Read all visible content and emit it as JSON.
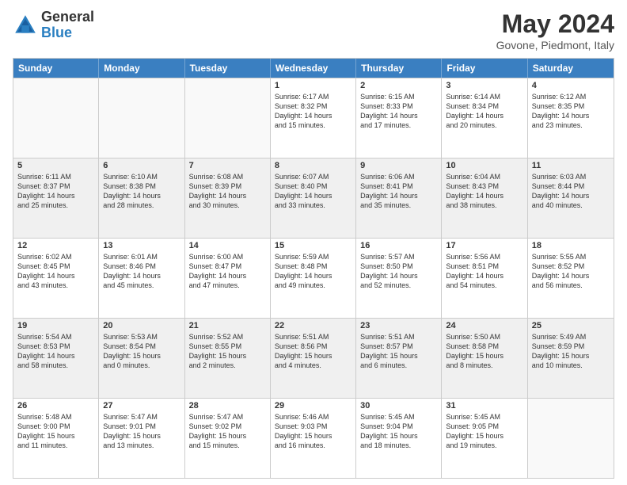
{
  "logo": {
    "general": "General",
    "blue": "Blue"
  },
  "title": "May 2024",
  "location": "Govone, Piedmont, Italy",
  "days": [
    "Sunday",
    "Monday",
    "Tuesday",
    "Wednesday",
    "Thursday",
    "Friday",
    "Saturday"
  ],
  "weeks": [
    [
      {
        "day": "",
        "info": ""
      },
      {
        "day": "",
        "info": ""
      },
      {
        "day": "",
        "info": ""
      },
      {
        "day": "1",
        "info": "Sunrise: 6:17 AM\nSunset: 8:32 PM\nDaylight: 14 hours\nand 15 minutes."
      },
      {
        "day": "2",
        "info": "Sunrise: 6:15 AM\nSunset: 8:33 PM\nDaylight: 14 hours\nand 17 minutes."
      },
      {
        "day": "3",
        "info": "Sunrise: 6:14 AM\nSunset: 8:34 PM\nDaylight: 14 hours\nand 20 minutes."
      },
      {
        "day": "4",
        "info": "Sunrise: 6:12 AM\nSunset: 8:35 PM\nDaylight: 14 hours\nand 23 minutes."
      }
    ],
    [
      {
        "day": "5",
        "info": "Sunrise: 6:11 AM\nSunset: 8:37 PM\nDaylight: 14 hours\nand 25 minutes."
      },
      {
        "day": "6",
        "info": "Sunrise: 6:10 AM\nSunset: 8:38 PM\nDaylight: 14 hours\nand 28 minutes."
      },
      {
        "day": "7",
        "info": "Sunrise: 6:08 AM\nSunset: 8:39 PM\nDaylight: 14 hours\nand 30 minutes."
      },
      {
        "day": "8",
        "info": "Sunrise: 6:07 AM\nSunset: 8:40 PM\nDaylight: 14 hours\nand 33 minutes."
      },
      {
        "day": "9",
        "info": "Sunrise: 6:06 AM\nSunset: 8:41 PM\nDaylight: 14 hours\nand 35 minutes."
      },
      {
        "day": "10",
        "info": "Sunrise: 6:04 AM\nSunset: 8:43 PM\nDaylight: 14 hours\nand 38 minutes."
      },
      {
        "day": "11",
        "info": "Sunrise: 6:03 AM\nSunset: 8:44 PM\nDaylight: 14 hours\nand 40 minutes."
      }
    ],
    [
      {
        "day": "12",
        "info": "Sunrise: 6:02 AM\nSunset: 8:45 PM\nDaylight: 14 hours\nand 43 minutes."
      },
      {
        "day": "13",
        "info": "Sunrise: 6:01 AM\nSunset: 8:46 PM\nDaylight: 14 hours\nand 45 minutes."
      },
      {
        "day": "14",
        "info": "Sunrise: 6:00 AM\nSunset: 8:47 PM\nDaylight: 14 hours\nand 47 minutes."
      },
      {
        "day": "15",
        "info": "Sunrise: 5:59 AM\nSunset: 8:48 PM\nDaylight: 14 hours\nand 49 minutes."
      },
      {
        "day": "16",
        "info": "Sunrise: 5:57 AM\nSunset: 8:50 PM\nDaylight: 14 hours\nand 52 minutes."
      },
      {
        "day": "17",
        "info": "Sunrise: 5:56 AM\nSunset: 8:51 PM\nDaylight: 14 hours\nand 54 minutes."
      },
      {
        "day": "18",
        "info": "Sunrise: 5:55 AM\nSunset: 8:52 PM\nDaylight: 14 hours\nand 56 minutes."
      }
    ],
    [
      {
        "day": "19",
        "info": "Sunrise: 5:54 AM\nSunset: 8:53 PM\nDaylight: 14 hours\nand 58 minutes."
      },
      {
        "day": "20",
        "info": "Sunrise: 5:53 AM\nSunset: 8:54 PM\nDaylight: 15 hours\nand 0 minutes."
      },
      {
        "day": "21",
        "info": "Sunrise: 5:52 AM\nSunset: 8:55 PM\nDaylight: 15 hours\nand 2 minutes."
      },
      {
        "day": "22",
        "info": "Sunrise: 5:51 AM\nSunset: 8:56 PM\nDaylight: 15 hours\nand 4 minutes."
      },
      {
        "day": "23",
        "info": "Sunrise: 5:51 AM\nSunset: 8:57 PM\nDaylight: 15 hours\nand 6 minutes."
      },
      {
        "day": "24",
        "info": "Sunrise: 5:50 AM\nSunset: 8:58 PM\nDaylight: 15 hours\nand 8 minutes."
      },
      {
        "day": "25",
        "info": "Sunrise: 5:49 AM\nSunset: 8:59 PM\nDaylight: 15 hours\nand 10 minutes."
      }
    ],
    [
      {
        "day": "26",
        "info": "Sunrise: 5:48 AM\nSunset: 9:00 PM\nDaylight: 15 hours\nand 11 minutes."
      },
      {
        "day": "27",
        "info": "Sunrise: 5:47 AM\nSunset: 9:01 PM\nDaylight: 15 hours\nand 13 minutes."
      },
      {
        "day": "28",
        "info": "Sunrise: 5:47 AM\nSunset: 9:02 PM\nDaylight: 15 hours\nand 15 minutes."
      },
      {
        "day": "29",
        "info": "Sunrise: 5:46 AM\nSunset: 9:03 PM\nDaylight: 15 hours\nand 16 minutes."
      },
      {
        "day": "30",
        "info": "Sunrise: 5:45 AM\nSunset: 9:04 PM\nDaylight: 15 hours\nand 18 minutes."
      },
      {
        "day": "31",
        "info": "Sunrise: 5:45 AM\nSunset: 9:05 PM\nDaylight: 15 hours\nand 19 minutes."
      },
      {
        "day": "",
        "info": ""
      }
    ]
  ]
}
